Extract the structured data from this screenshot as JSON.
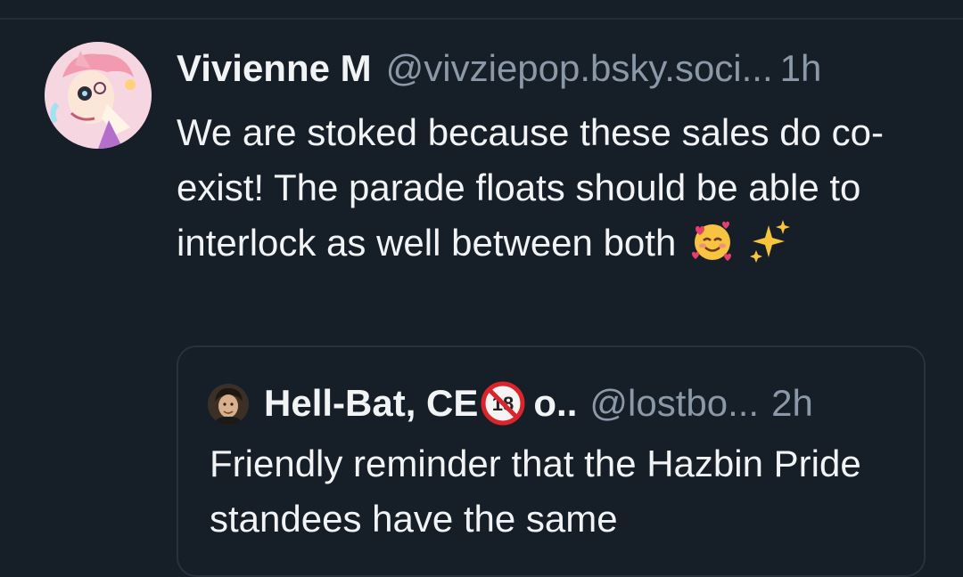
{
  "post": {
    "author_name": "Vivienne M",
    "author_handle": "@vivziepop.bsky.soci...",
    "timestamp": "1h",
    "text": "We are stoked because these sales do co-exist! The parade floats should be able to interlock as well between both",
    "emojis": [
      "🥰",
      "✨"
    ],
    "avatar_icon": "illustrated-character-avatar"
  },
  "quote": {
    "author_name": "Hell-Bat, CE",
    "author_name_suffix": "o..",
    "badge_icon": "no-under-18-icon",
    "author_handle": "@lostbo...",
    "timestamp": "2h",
    "text": "Friendly reminder that the Hazbin Pride standees have the same",
    "avatar_icon": "user-photo-avatar"
  },
  "colors": {
    "background": "#161e27",
    "text_primary": "#f1f3f5",
    "text_secondary": "#8a98a8",
    "border": "#27323e"
  }
}
